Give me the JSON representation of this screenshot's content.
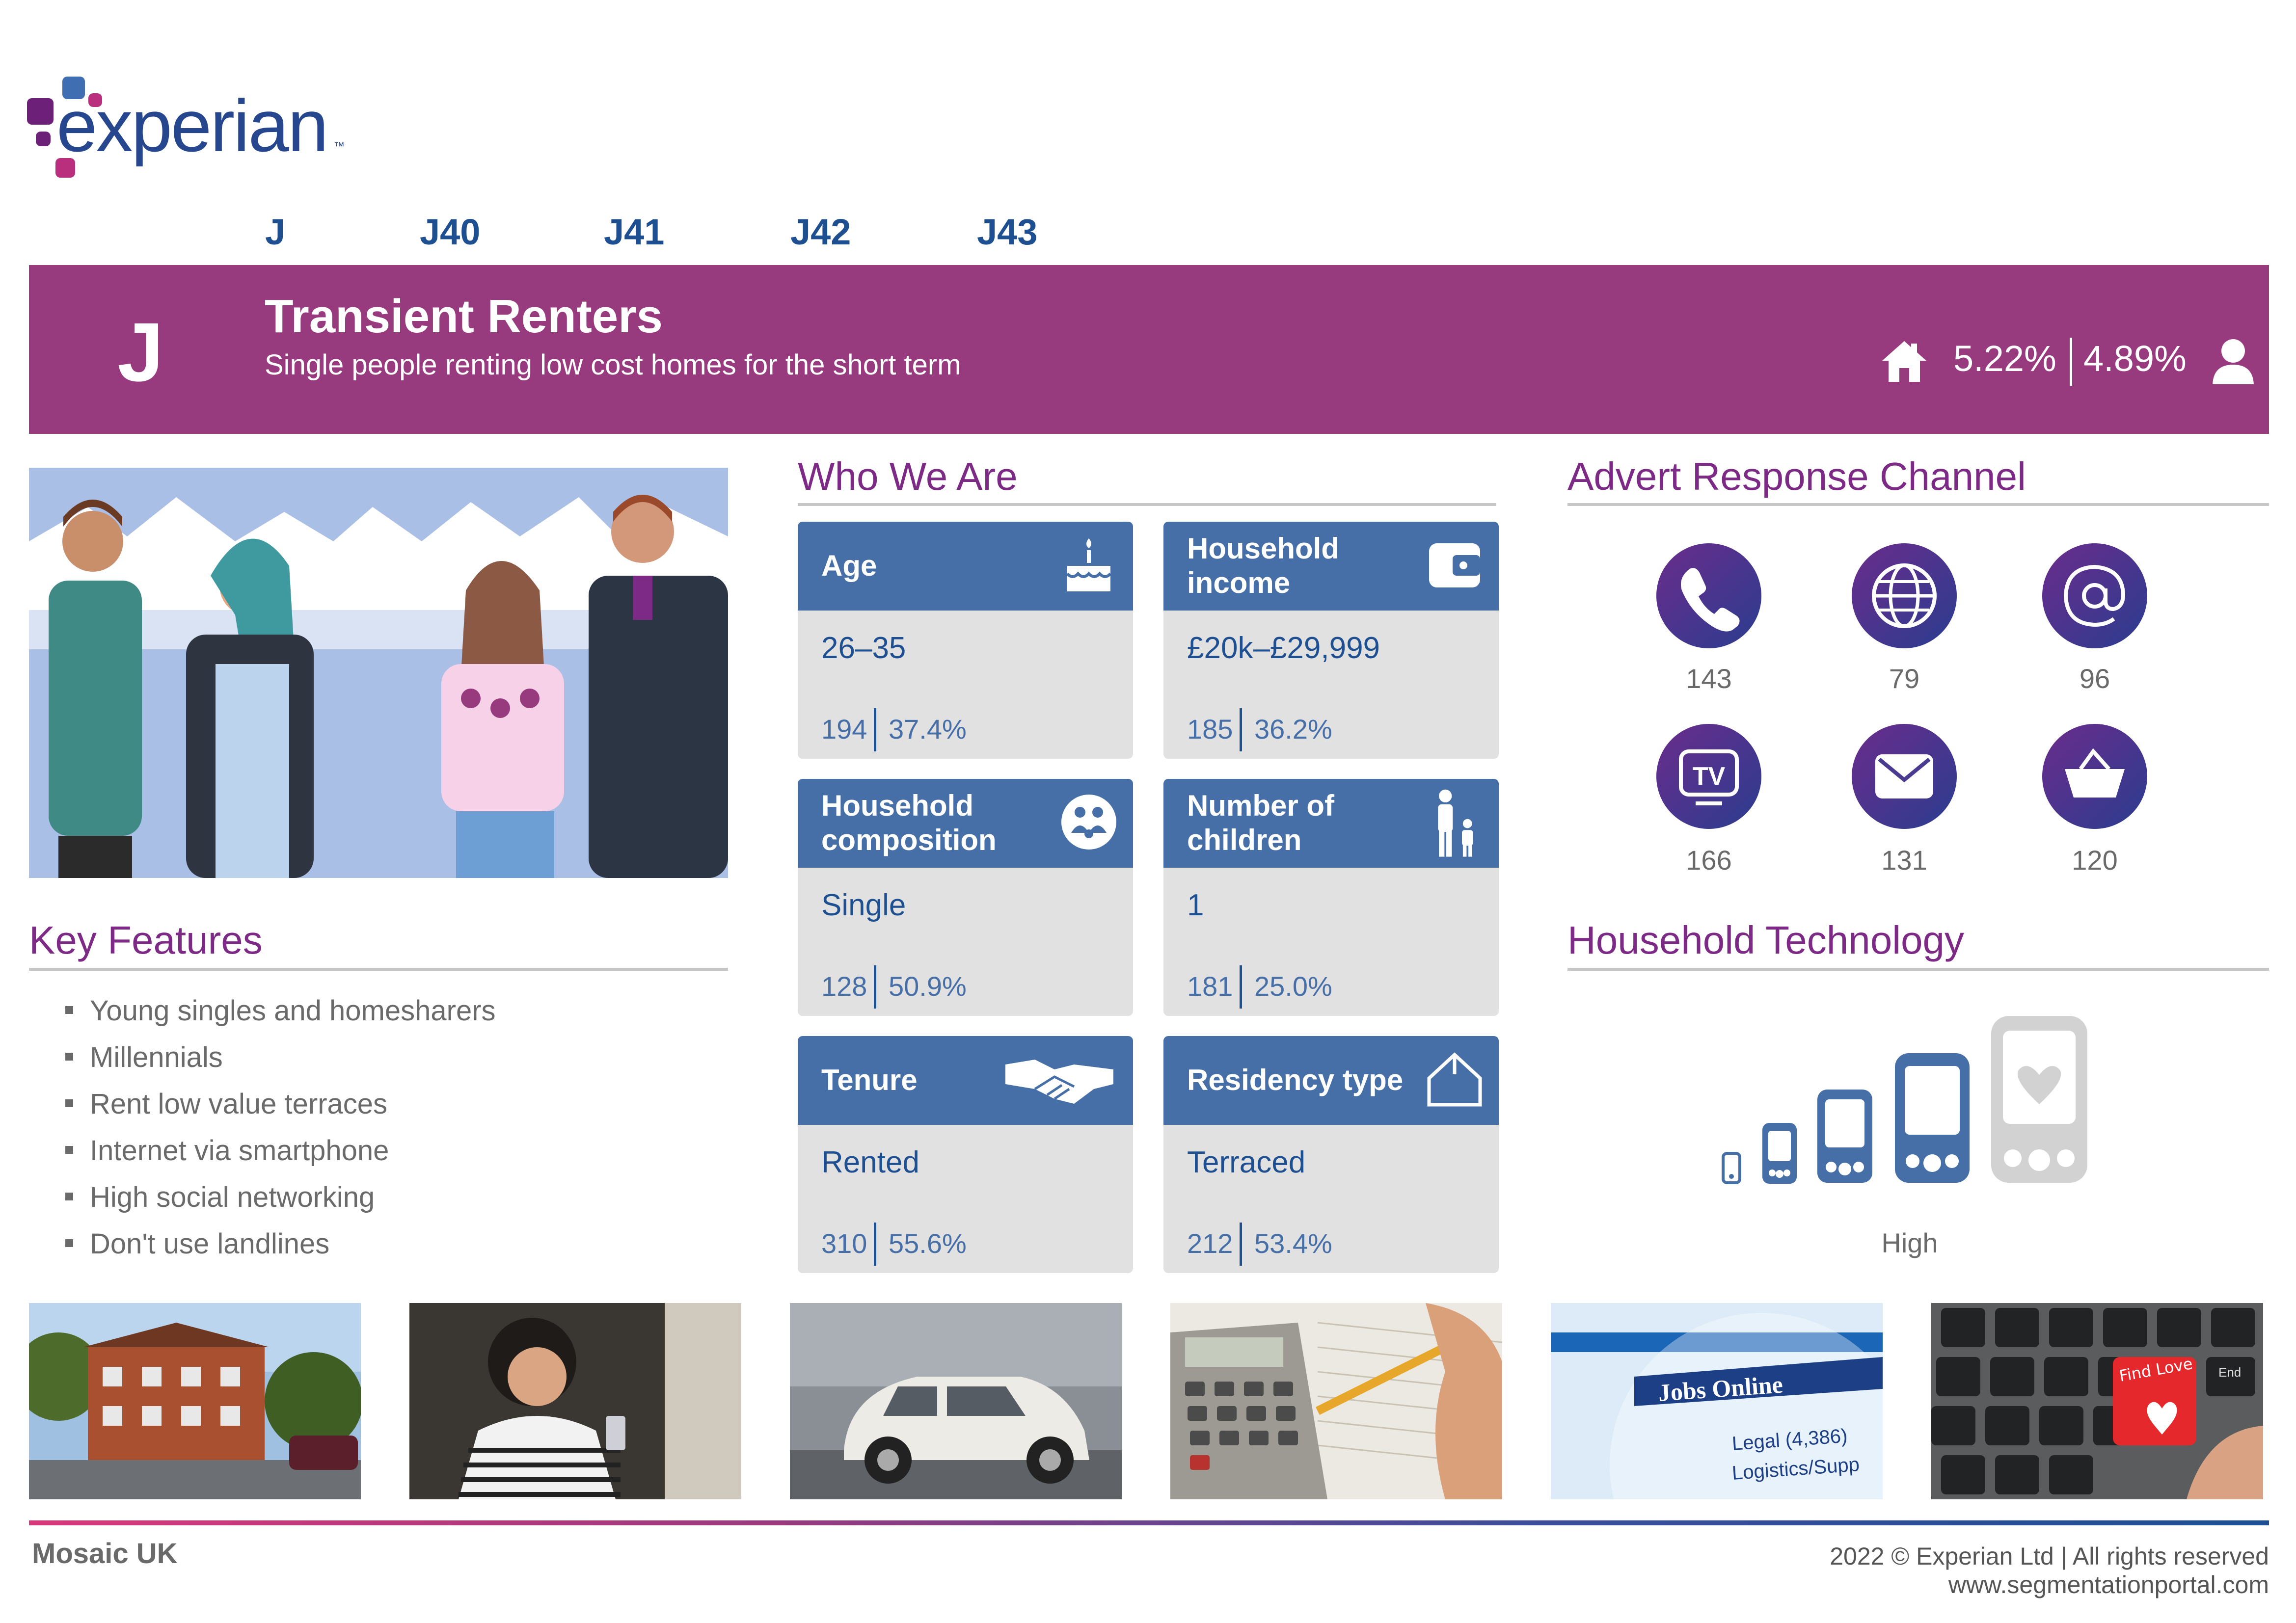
{
  "brand": {
    "logo_text": "experian",
    "logo_tm": "™",
    "colors": {
      "purple": "#983a7e",
      "navy": "#1d4f91",
      "blue": "#466fa8",
      "magenta": "#d6397a"
    }
  },
  "nav": [
    "J",
    "J40",
    "J41",
    "J42",
    "J43"
  ],
  "banner": {
    "letter": "J",
    "title": "Transient Renters",
    "subtitle": "Single people renting low cost homes for the short term",
    "household_pct": "5.22%",
    "person_pct": "4.89%",
    "icons": [
      "house-icon",
      "person-icon"
    ]
  },
  "key_features": {
    "title": "Key Features",
    "items": [
      "Young singles and homesharers",
      "Millennials",
      "Rent low value terraces",
      "Internet via smartphone",
      "High social networking",
      "Don't use landlines"
    ]
  },
  "who_we_are": {
    "title": "Who We Are",
    "cards": [
      {
        "label": "Age",
        "value": "26–35",
        "index": "194",
        "pct": "37.4%",
        "icon": "birthday-cake-icon"
      },
      {
        "label": "Household income",
        "label_lines": [
          "Household",
          "income"
        ],
        "value": "£20k–£29,999",
        "index": "185",
        "pct": "36.2%",
        "icon": "wallet-icon"
      },
      {
        "label": "Household composition",
        "label_lines": [
          "Household",
          "composition"
        ],
        "value": "Single",
        "index": "128",
        "pct": "50.9%",
        "icon": "people-circle-icon"
      },
      {
        "label": "Number of children",
        "label_lines": [
          "Number of",
          "children"
        ],
        "value": "1",
        "index": "181",
        "pct": "25.0%",
        "icon": "parent-child-icon"
      },
      {
        "label": "Tenure",
        "value": "Rented",
        "index": "310",
        "pct": "55.6%",
        "icon": "handshake-icon"
      },
      {
        "label": "Residency type",
        "value": "Terraced",
        "index": "212",
        "pct": "53.4%",
        "icon": "house-outline-icon"
      }
    ]
  },
  "advert_response": {
    "title": "Advert Response Channel",
    "channels": [
      {
        "icon": "phone-icon",
        "value": "143"
      },
      {
        "icon": "globe-icon",
        "value": "79"
      },
      {
        "icon": "at-icon",
        "value": "96"
      },
      {
        "icon": "tv-icon",
        "value": "166",
        "glyph": "TV"
      },
      {
        "icon": "mail-icon",
        "value": "131"
      },
      {
        "icon": "basket-icon",
        "value": "120"
      }
    ]
  },
  "household_technology": {
    "title": "Household Technology",
    "level": "High",
    "level_index": 4,
    "level_max": 5
  },
  "photos": {
    "jobs_text": "Jobs Online",
    "jobs_sub1": "Legal (4,386)",
    "jobs_sub2": "Logistics/Supp",
    "keyboard_text": "Find Love",
    "keyboard_end": "End"
  },
  "footer": {
    "left": "Mosaic UK",
    "copyright": "2022 © Experian Ltd | All rights reserved",
    "url": "www.segmentationportal.com"
  }
}
